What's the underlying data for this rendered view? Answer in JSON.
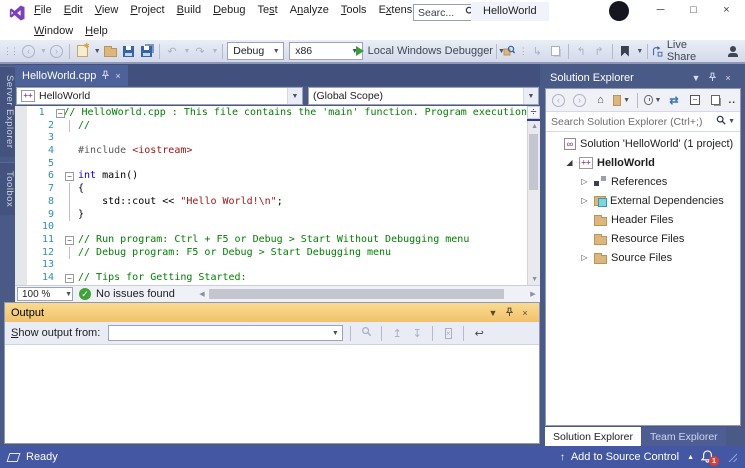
{
  "title_bar": {
    "menus": [
      {
        "label": "File",
        "u": 0,
        "row": 1
      },
      {
        "label": "Edit",
        "u": 0,
        "row": 1
      },
      {
        "label": "View",
        "u": 0,
        "row": 1
      },
      {
        "label": "Project",
        "u": 0,
        "row": 1
      },
      {
        "label": "Build",
        "u": 0,
        "row": 1
      },
      {
        "label": "Debug",
        "u": 0,
        "row": 1
      },
      {
        "label": "Test",
        "u": 2,
        "row": 1
      },
      {
        "label": "Analyze",
        "u": 1,
        "row": 1
      },
      {
        "label": "Tools",
        "u": 0,
        "row": 1
      },
      {
        "label": "Extensions",
        "u": 1,
        "row": 1
      },
      {
        "label": "Window",
        "u": 0,
        "row": 2
      },
      {
        "label": "Help",
        "u": 0,
        "row": 2
      }
    ],
    "search_placeholder": "Searc...",
    "window_title": "HelloWorld"
  },
  "toolbar": {
    "configuration": "Debug",
    "platform": "x86",
    "run_label": "Local Windows Debugger",
    "live_share_label": "Live Share"
  },
  "editor": {
    "tab_label": "HelloWorld.cpp",
    "nav_project": "HelloWorld",
    "nav_scope": "(Global Scope)",
    "zoom_level": "100 %",
    "health_status": "No issues found",
    "lines": [
      {
        "n": 1,
        "fold": true,
        "segs": [
          {
            "c": "com",
            "t": "// HelloWorld.cpp : This file contains the 'main' function. Program execution"
          }
        ]
      },
      {
        "n": 2,
        "g": 1,
        "segs": [
          {
            "c": "com",
            "t": "//"
          }
        ]
      },
      {
        "n": 3,
        "segs": []
      },
      {
        "n": 4,
        "segs": [
          {
            "c": "pre",
            "t": "#include "
          },
          {
            "c": "str",
            "t": "<iostream>"
          }
        ]
      },
      {
        "n": 5,
        "segs": []
      },
      {
        "n": 6,
        "fold": true,
        "segs": [
          {
            "c": "kw",
            "t": "int"
          },
          {
            "c": "pln",
            "t": " main()"
          }
        ]
      },
      {
        "n": 7,
        "g": 1,
        "segs": [
          {
            "c": "pln",
            "t": "{"
          }
        ]
      },
      {
        "n": 8,
        "g": 1,
        "segs": [
          {
            "c": "pln",
            "t": "    std::cout << "
          },
          {
            "c": "str",
            "t": "\"Hello World!\\n\""
          },
          {
            "c": "pln",
            "t": ";"
          }
        ]
      },
      {
        "n": 9,
        "g": 1,
        "segs": [
          {
            "c": "pln",
            "t": "}"
          }
        ]
      },
      {
        "n": 10,
        "segs": []
      },
      {
        "n": 11,
        "fold": true,
        "segs": [
          {
            "c": "com",
            "t": "// Run program: Ctrl + F5 or Debug > Start Without Debugging menu"
          }
        ]
      },
      {
        "n": 12,
        "g": 1,
        "segs": [
          {
            "c": "com",
            "t": "// Debug program: F5 or Debug > Start Debugging menu"
          }
        ]
      },
      {
        "n": 13,
        "segs": []
      },
      {
        "n": 14,
        "fold": true,
        "segs": [
          {
            "c": "com",
            "t": "// Tips for Getting Started:"
          }
        ]
      }
    ]
  },
  "output_panel": {
    "title": "Output",
    "label": "Show output from:",
    "selected_source": ""
  },
  "solution_explorer": {
    "title": "Solution Explorer",
    "search_placeholder": "Search Solution Explorer (Ctrl+;)",
    "overflow": "..",
    "tree": [
      {
        "icon": "solution",
        "label": "Solution 'HelloWorld' (1 project)",
        "indent": 0,
        "arrow": "none",
        "bold": false
      },
      {
        "icon": "cpp-project",
        "label": "HelloWorld",
        "indent": 1,
        "arrow": "expanded",
        "bold": true
      },
      {
        "icon": "references",
        "label": "References",
        "indent": 2,
        "arrow": "collapsed",
        "bold": false
      },
      {
        "icon": "external-deps",
        "label": "External Dependencies",
        "indent": 2,
        "arrow": "collapsed",
        "bold": false
      },
      {
        "icon": "folder",
        "label": "Header Files",
        "indent": 2,
        "arrow": "none",
        "bold": false
      },
      {
        "icon": "folder",
        "label": "Resource Files",
        "indent": 2,
        "arrow": "none",
        "bold": false
      },
      {
        "icon": "folder",
        "label": "Source Files",
        "indent": 2,
        "arrow": "collapsed",
        "bold": false
      }
    ],
    "bottom_tabs": [
      {
        "label": "Solution Explorer",
        "active": true
      },
      {
        "label": "Team Explorer",
        "active": false
      }
    ]
  },
  "status_bar": {
    "state": "Ready",
    "source_control": "Add to Source Control",
    "notification_count": "1"
  },
  "side_tabs": [
    "Server Explorer",
    "Toolbox"
  ],
  "icons": {
    "search-icon": "magnifier svg",
    "save-icon": "blue floppy",
    "folder-icon": "tan folder",
    "run-icon": "green triangle",
    "pin-icon": "push pin svg",
    "close-icon": "×",
    "chevron-down-icon": "▾",
    "bell-icon": "bell svg",
    "home-icon": "⌂",
    "sync-icon": "⇄",
    "fold-collapse-icon": "⊟"
  }
}
